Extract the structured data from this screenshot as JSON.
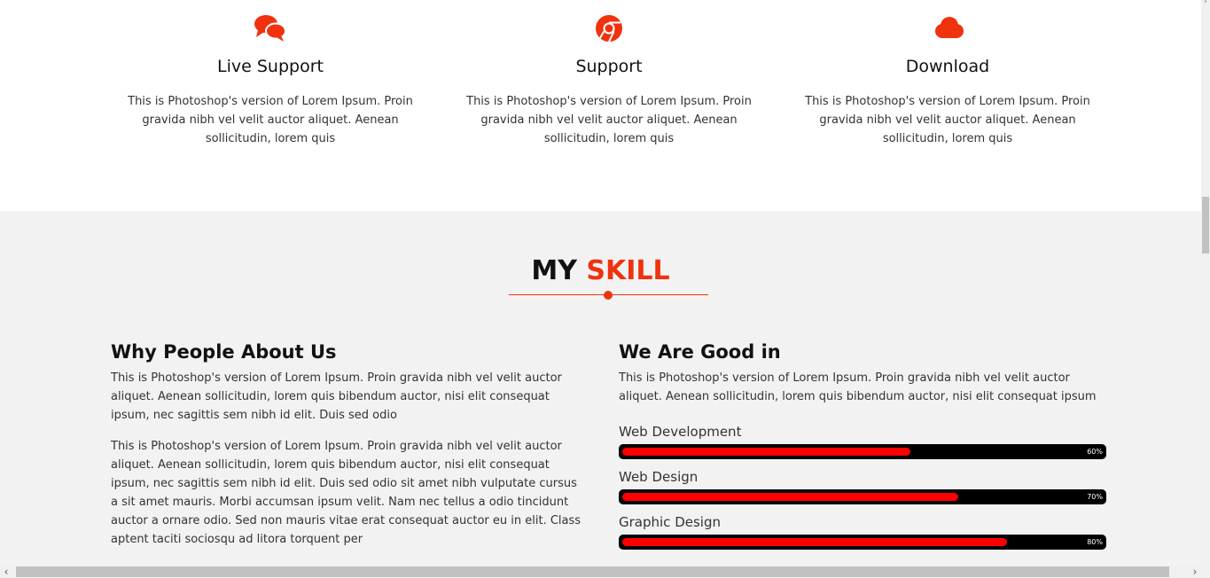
{
  "colors": {
    "accent": "#f0320f",
    "bar_fill": "#ff0000",
    "bar_track": "#000000",
    "section_bg": "#f2f2f2"
  },
  "services": [
    {
      "icon": "chat-bubbles-icon",
      "title": "Live Support",
      "description": "This is Photoshop's version of Lorem Ipsum. Proin gravida nibh vel velit auctor aliquet. Aenean sollicitudin, lorem quis"
    },
    {
      "icon": "chrome-icon",
      "title": "Support",
      "description": "This is Photoshop's version of Lorem Ipsum. Proin gravida nibh vel velit auctor aliquet. Aenean sollicitudin, lorem quis"
    },
    {
      "icon": "cloud-icon",
      "title": "Download",
      "description": "This is Photoshop's version of Lorem Ipsum. Proin gravida nibh vel velit auctor aliquet. Aenean sollicitudin, lorem quis"
    }
  ],
  "skill_section": {
    "title_main": "MY",
    "title_accent": "SKILL",
    "left": {
      "heading": "Why People About Us",
      "paragraph1": "This is Photoshop's version of Lorem Ipsum. Proin gravida nibh vel velit auctor aliquet. Aenean sollicitudin, lorem quis bibendum auctor, nisi elit consequat ipsum, nec sagittis sem nibh id elit. Duis sed odio",
      "paragraph2": "This is Photoshop's version of Lorem Ipsum. Proin gravida nibh vel velit auctor aliquet. Aenean sollicitudin, lorem quis bibendum auctor, nisi elit consequat ipsum, nec sagittis sem nibh id elit. Duis sed odio sit amet nibh vulputate cursus a sit amet mauris. Morbi accumsan ipsum velit. Nam nec tellus a odio tincidunt auctor a ornare odio. Sed non mauris vitae erat consequat auctor eu in elit. Class aptent taciti sociosqu ad litora torquent per"
    },
    "right": {
      "heading": "We Are Good in",
      "paragraph": "This is Photoshop's version of Lorem Ipsum. Proin gravida nibh vel velit auctor aliquet. Aenean sollicitudin, lorem quis bibendum auctor, nisi elit consequat ipsum",
      "skills": [
        {
          "label": "Web Development",
          "percent_label": "60%",
          "value": 0.6
        },
        {
          "label": "Web Design",
          "percent_label": "70%",
          "value": 0.7
        },
        {
          "label": "Graphic Design",
          "percent_label": "80%",
          "value": 0.8
        }
      ]
    }
  },
  "scrollbar": {
    "left_arrow": "‹",
    "right_arrow": "›",
    "up_arrow": "˄"
  }
}
